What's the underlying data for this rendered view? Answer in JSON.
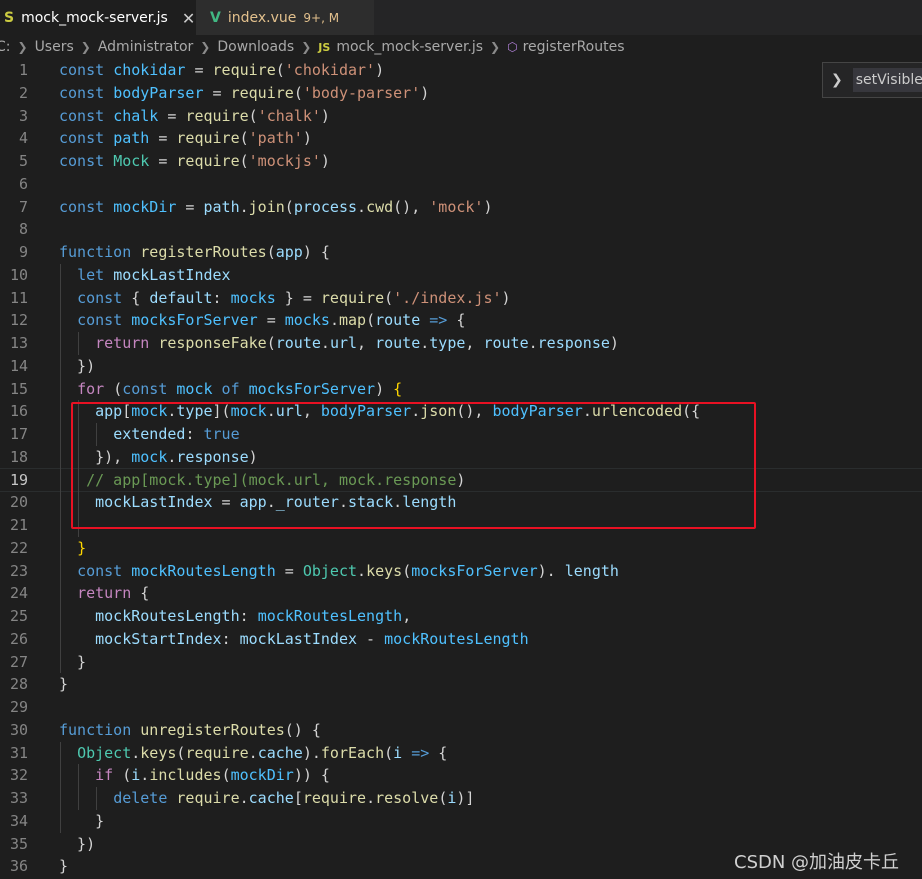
{
  "tabs": [
    {
      "icon": "S",
      "label": "mock_mock-server.js",
      "close": "✕",
      "active": true
    },
    {
      "icon": "V",
      "label": "index.vue",
      "badge": "9+, M",
      "active": false
    }
  ],
  "breadcrumb": {
    "parts": [
      "C:",
      "Users",
      "Administrator",
      "Downloads"
    ],
    "file_icon": "JS",
    "file": "mock_mock-server.js",
    "symbol": "registerRoutes"
  },
  "hover_widget": {
    "label": "setVisibleF"
  },
  "watermark": "CSDN @加油皮卡丘",
  "colors": {
    "keyword": "#569cd6",
    "variable": "#9cdcfe",
    "string": "#ce9178",
    "function": "#dcdcaa",
    "comment": "#6a9955",
    "highlight_box": "#e81123",
    "js_icon": "#cbcb41",
    "vue_icon": "#41b883",
    "modified": "#e2c08d"
  },
  "code_lines": [
    [
      [
        "t-kw",
        "const "
      ],
      [
        "t-const",
        "chokidar"
      ],
      [
        "t-pun",
        " = "
      ],
      [
        "t-fn",
        "require"
      ],
      [
        "t-pun",
        "("
      ],
      [
        "t-str",
        "'chokidar'"
      ],
      [
        "t-pun",
        ")"
      ]
    ],
    [
      [
        "t-kw",
        "const "
      ],
      [
        "t-const",
        "bodyParser"
      ],
      [
        "t-pun",
        " = "
      ],
      [
        "t-fn",
        "require"
      ],
      [
        "t-pun",
        "("
      ],
      [
        "t-str",
        "'body-parser'"
      ],
      [
        "t-pun",
        ")"
      ]
    ],
    [
      [
        "t-kw",
        "const "
      ],
      [
        "t-const",
        "chalk"
      ],
      [
        "t-pun",
        " = "
      ],
      [
        "t-fn",
        "require"
      ],
      [
        "t-pun",
        "("
      ],
      [
        "t-str",
        "'chalk'"
      ],
      [
        "t-pun",
        ")"
      ]
    ],
    [
      [
        "t-kw",
        "const "
      ],
      [
        "t-const",
        "path"
      ],
      [
        "t-pun",
        " = "
      ],
      [
        "t-fn",
        "require"
      ],
      [
        "t-pun",
        "("
      ],
      [
        "t-str",
        "'path'"
      ],
      [
        "t-pun",
        ")"
      ]
    ],
    [
      [
        "t-kw",
        "const "
      ],
      [
        "t-cls",
        "Mock"
      ],
      [
        "t-pun",
        " = "
      ],
      [
        "t-fn",
        "require"
      ],
      [
        "t-pun",
        "("
      ],
      [
        "t-str",
        "'mockjs'"
      ],
      [
        "t-pun",
        ")"
      ]
    ],
    [],
    [
      [
        "t-kw",
        "const "
      ],
      [
        "t-const",
        "mockDir"
      ],
      [
        "t-pun",
        " = "
      ],
      [
        "t-var",
        "path"
      ],
      [
        "t-pun",
        "."
      ],
      [
        "t-fn",
        "join"
      ],
      [
        "t-pun",
        "("
      ],
      [
        "t-var",
        "process"
      ],
      [
        "t-pun",
        "."
      ],
      [
        "t-fn",
        "cwd"
      ],
      [
        "t-pun",
        "(), "
      ],
      [
        "t-str",
        "'mock'"
      ],
      [
        "t-pun",
        ")"
      ]
    ],
    [],
    [
      [
        "t-kw",
        "function "
      ],
      [
        "t-fn",
        "registerRoutes"
      ],
      [
        "t-pun",
        "("
      ],
      [
        "t-var",
        "app"
      ],
      [
        "t-pun",
        ") {"
      ]
    ],
    [
      [
        "t-pun",
        "  "
      ],
      [
        "t-kw",
        "let "
      ],
      [
        "t-var",
        "mockLastIndex"
      ]
    ],
    [
      [
        "t-pun",
        "  "
      ],
      [
        "t-kw",
        "const "
      ],
      [
        "t-pun",
        "{ "
      ],
      [
        "t-var",
        "default"
      ],
      [
        "t-pun",
        ": "
      ],
      [
        "t-const",
        "mocks"
      ],
      [
        "t-pun",
        " } = "
      ],
      [
        "t-fn",
        "require"
      ],
      [
        "t-pun",
        "("
      ],
      [
        "t-str",
        "'./index.js'"
      ],
      [
        "t-pun",
        ")"
      ]
    ],
    [
      [
        "t-pun",
        "  "
      ],
      [
        "t-kw",
        "const "
      ],
      [
        "t-const",
        "mocksForServer"
      ],
      [
        "t-pun",
        " = "
      ],
      [
        "t-const",
        "mocks"
      ],
      [
        "t-pun",
        "."
      ],
      [
        "t-fn",
        "map"
      ],
      [
        "t-pun",
        "("
      ],
      [
        "t-var",
        "route"
      ],
      [
        "t-kw",
        " =>"
      ],
      [
        "t-pun",
        " {"
      ]
    ],
    [
      [
        "t-pun",
        "    "
      ],
      [
        "t-ctl",
        "return "
      ],
      [
        "t-fn",
        "responseFake"
      ],
      [
        "t-pun",
        "("
      ],
      [
        "t-var",
        "route"
      ],
      [
        "t-pun",
        "."
      ],
      [
        "t-var",
        "url"
      ],
      [
        "t-pun",
        ", "
      ],
      [
        "t-var",
        "route"
      ],
      [
        "t-pun",
        "."
      ],
      [
        "t-var",
        "type"
      ],
      [
        "t-pun",
        ", "
      ],
      [
        "t-var",
        "route"
      ],
      [
        "t-pun",
        "."
      ],
      [
        "t-var",
        "response"
      ],
      [
        "t-pun",
        ")"
      ]
    ],
    [
      [
        "t-pun",
        "  })"
      ]
    ],
    [
      [
        "t-pun",
        "  "
      ],
      [
        "t-ctl",
        "for "
      ],
      [
        "t-pun",
        "("
      ],
      [
        "t-kw",
        "const "
      ],
      [
        "t-const",
        "mock"
      ],
      [
        "t-kw",
        " of "
      ],
      [
        "t-const",
        "mocksForServer"
      ],
      [
        "t-pun",
        ") "
      ],
      [
        "t-brk",
        "{"
      ]
    ],
    [
      [
        "t-pun",
        "    "
      ],
      [
        "t-var",
        "app"
      ],
      [
        "t-pun",
        "["
      ],
      [
        "t-const",
        "mock"
      ],
      [
        "t-pun",
        "."
      ],
      [
        "t-var",
        "type"
      ],
      [
        "t-pun",
        "]("
      ],
      [
        "t-const",
        "mock"
      ],
      [
        "t-pun",
        "."
      ],
      [
        "t-var",
        "url"
      ],
      [
        "t-pun",
        ", "
      ],
      [
        "t-const",
        "bodyParser"
      ],
      [
        "t-pun",
        "."
      ],
      [
        "t-fn",
        "json"
      ],
      [
        "t-pun",
        "(), "
      ],
      [
        "t-const",
        "bodyParser"
      ],
      [
        "t-pun",
        "."
      ],
      [
        "t-fn",
        "urlencoded"
      ],
      [
        "t-pun",
        "({"
      ]
    ],
    [
      [
        "t-pun",
        "      "
      ],
      [
        "t-var",
        "extended"
      ],
      [
        "t-pun",
        ": "
      ],
      [
        "t-bool",
        "true"
      ]
    ],
    [
      [
        "t-pun",
        "    }), "
      ],
      [
        "t-const",
        "mock"
      ],
      [
        "t-pun",
        "."
      ],
      [
        "t-var",
        "response"
      ],
      [
        "t-pun",
        ")"
      ]
    ],
    [
      [
        "t-com",
        "   // app[mock.type](mock.url, mock.response"
      ],
      [
        "t-pun",
        ")"
      ]
    ],
    [
      [
        "t-pun",
        "    "
      ],
      [
        "t-var",
        "mockLastIndex"
      ],
      [
        "t-pun",
        " = "
      ],
      [
        "t-var",
        "app"
      ],
      [
        "t-pun",
        "."
      ],
      [
        "t-var",
        "_router"
      ],
      [
        "t-pun",
        "."
      ],
      [
        "t-var",
        "stack"
      ],
      [
        "t-pun",
        "."
      ],
      [
        "t-var",
        "length"
      ]
    ],
    [],
    [
      [
        "t-pun",
        "  "
      ],
      [
        "t-brk",
        "}"
      ]
    ],
    [
      [
        "t-pun",
        "  "
      ],
      [
        "t-kw",
        "const "
      ],
      [
        "t-const",
        "mockRoutesLength"
      ],
      [
        "t-pun",
        " = "
      ],
      [
        "t-cls",
        "Object"
      ],
      [
        "t-pun",
        "."
      ],
      [
        "t-fn",
        "keys"
      ],
      [
        "t-pun",
        "("
      ],
      [
        "t-const",
        "mocksForServer"
      ],
      [
        "t-pun",
        "). "
      ],
      [
        "t-var",
        "length"
      ]
    ],
    [
      [
        "t-pun",
        "  "
      ],
      [
        "t-ctl",
        "return "
      ],
      [
        "t-pun",
        "{"
      ]
    ],
    [
      [
        "t-pun",
        "    "
      ],
      [
        "t-var",
        "mockRoutesLength"
      ],
      [
        "t-pun",
        ": "
      ],
      [
        "t-const",
        "mockRoutesLength"
      ],
      [
        "t-pun",
        ","
      ]
    ],
    [
      [
        "t-pun",
        "    "
      ],
      [
        "t-var",
        "mockStartIndex"
      ],
      [
        "t-pun",
        ": "
      ],
      [
        "t-var",
        "mockLastIndex"
      ],
      [
        "t-pun",
        " - "
      ],
      [
        "t-const",
        "mockRoutesLength"
      ]
    ],
    [
      [
        "t-pun",
        "  }"
      ]
    ],
    [
      [
        "t-pun",
        "}"
      ]
    ],
    [],
    [
      [
        "t-kw",
        "function "
      ],
      [
        "t-fn",
        "unregisterRoutes"
      ],
      [
        "t-pun",
        "() {"
      ]
    ],
    [
      [
        "t-pun",
        "  "
      ],
      [
        "t-cls",
        "Object"
      ],
      [
        "t-pun",
        "."
      ],
      [
        "t-fn",
        "keys"
      ],
      [
        "t-pun",
        "("
      ],
      [
        "t-fn",
        "require"
      ],
      [
        "t-pun",
        "."
      ],
      [
        "t-var",
        "cache"
      ],
      [
        "t-pun",
        ")."
      ],
      [
        "t-fn",
        "forEach"
      ],
      [
        "t-pun",
        "("
      ],
      [
        "t-var",
        "i"
      ],
      [
        "t-kw",
        " =>"
      ],
      [
        "t-pun",
        " {"
      ]
    ],
    [
      [
        "t-pun",
        "    "
      ],
      [
        "t-ctl",
        "if "
      ],
      [
        "t-pun",
        "("
      ],
      [
        "t-var",
        "i"
      ],
      [
        "t-pun",
        "."
      ],
      [
        "t-fn",
        "includes"
      ],
      [
        "t-pun",
        "("
      ],
      [
        "t-const",
        "mockDir"
      ],
      [
        "t-pun",
        ")) {"
      ]
    ],
    [
      [
        "t-pun",
        "      "
      ],
      [
        "t-kw",
        "delete "
      ],
      [
        "t-fn",
        "require"
      ],
      [
        "t-pun",
        "."
      ],
      [
        "t-var",
        "cache"
      ],
      [
        "t-pun",
        "["
      ],
      [
        "t-fn",
        "require"
      ],
      [
        "t-pun",
        "."
      ],
      [
        "t-fn",
        "resolve"
      ],
      [
        "t-pun",
        "("
      ],
      [
        "t-var",
        "i"
      ],
      [
        "t-pun",
        ")]"
      ]
    ],
    [
      [
        "t-pun",
        "    }"
      ]
    ],
    [
      [
        "t-pun",
        "  })"
      ]
    ],
    [
      [
        "t-pun",
        "}"
      ]
    ]
  ]
}
